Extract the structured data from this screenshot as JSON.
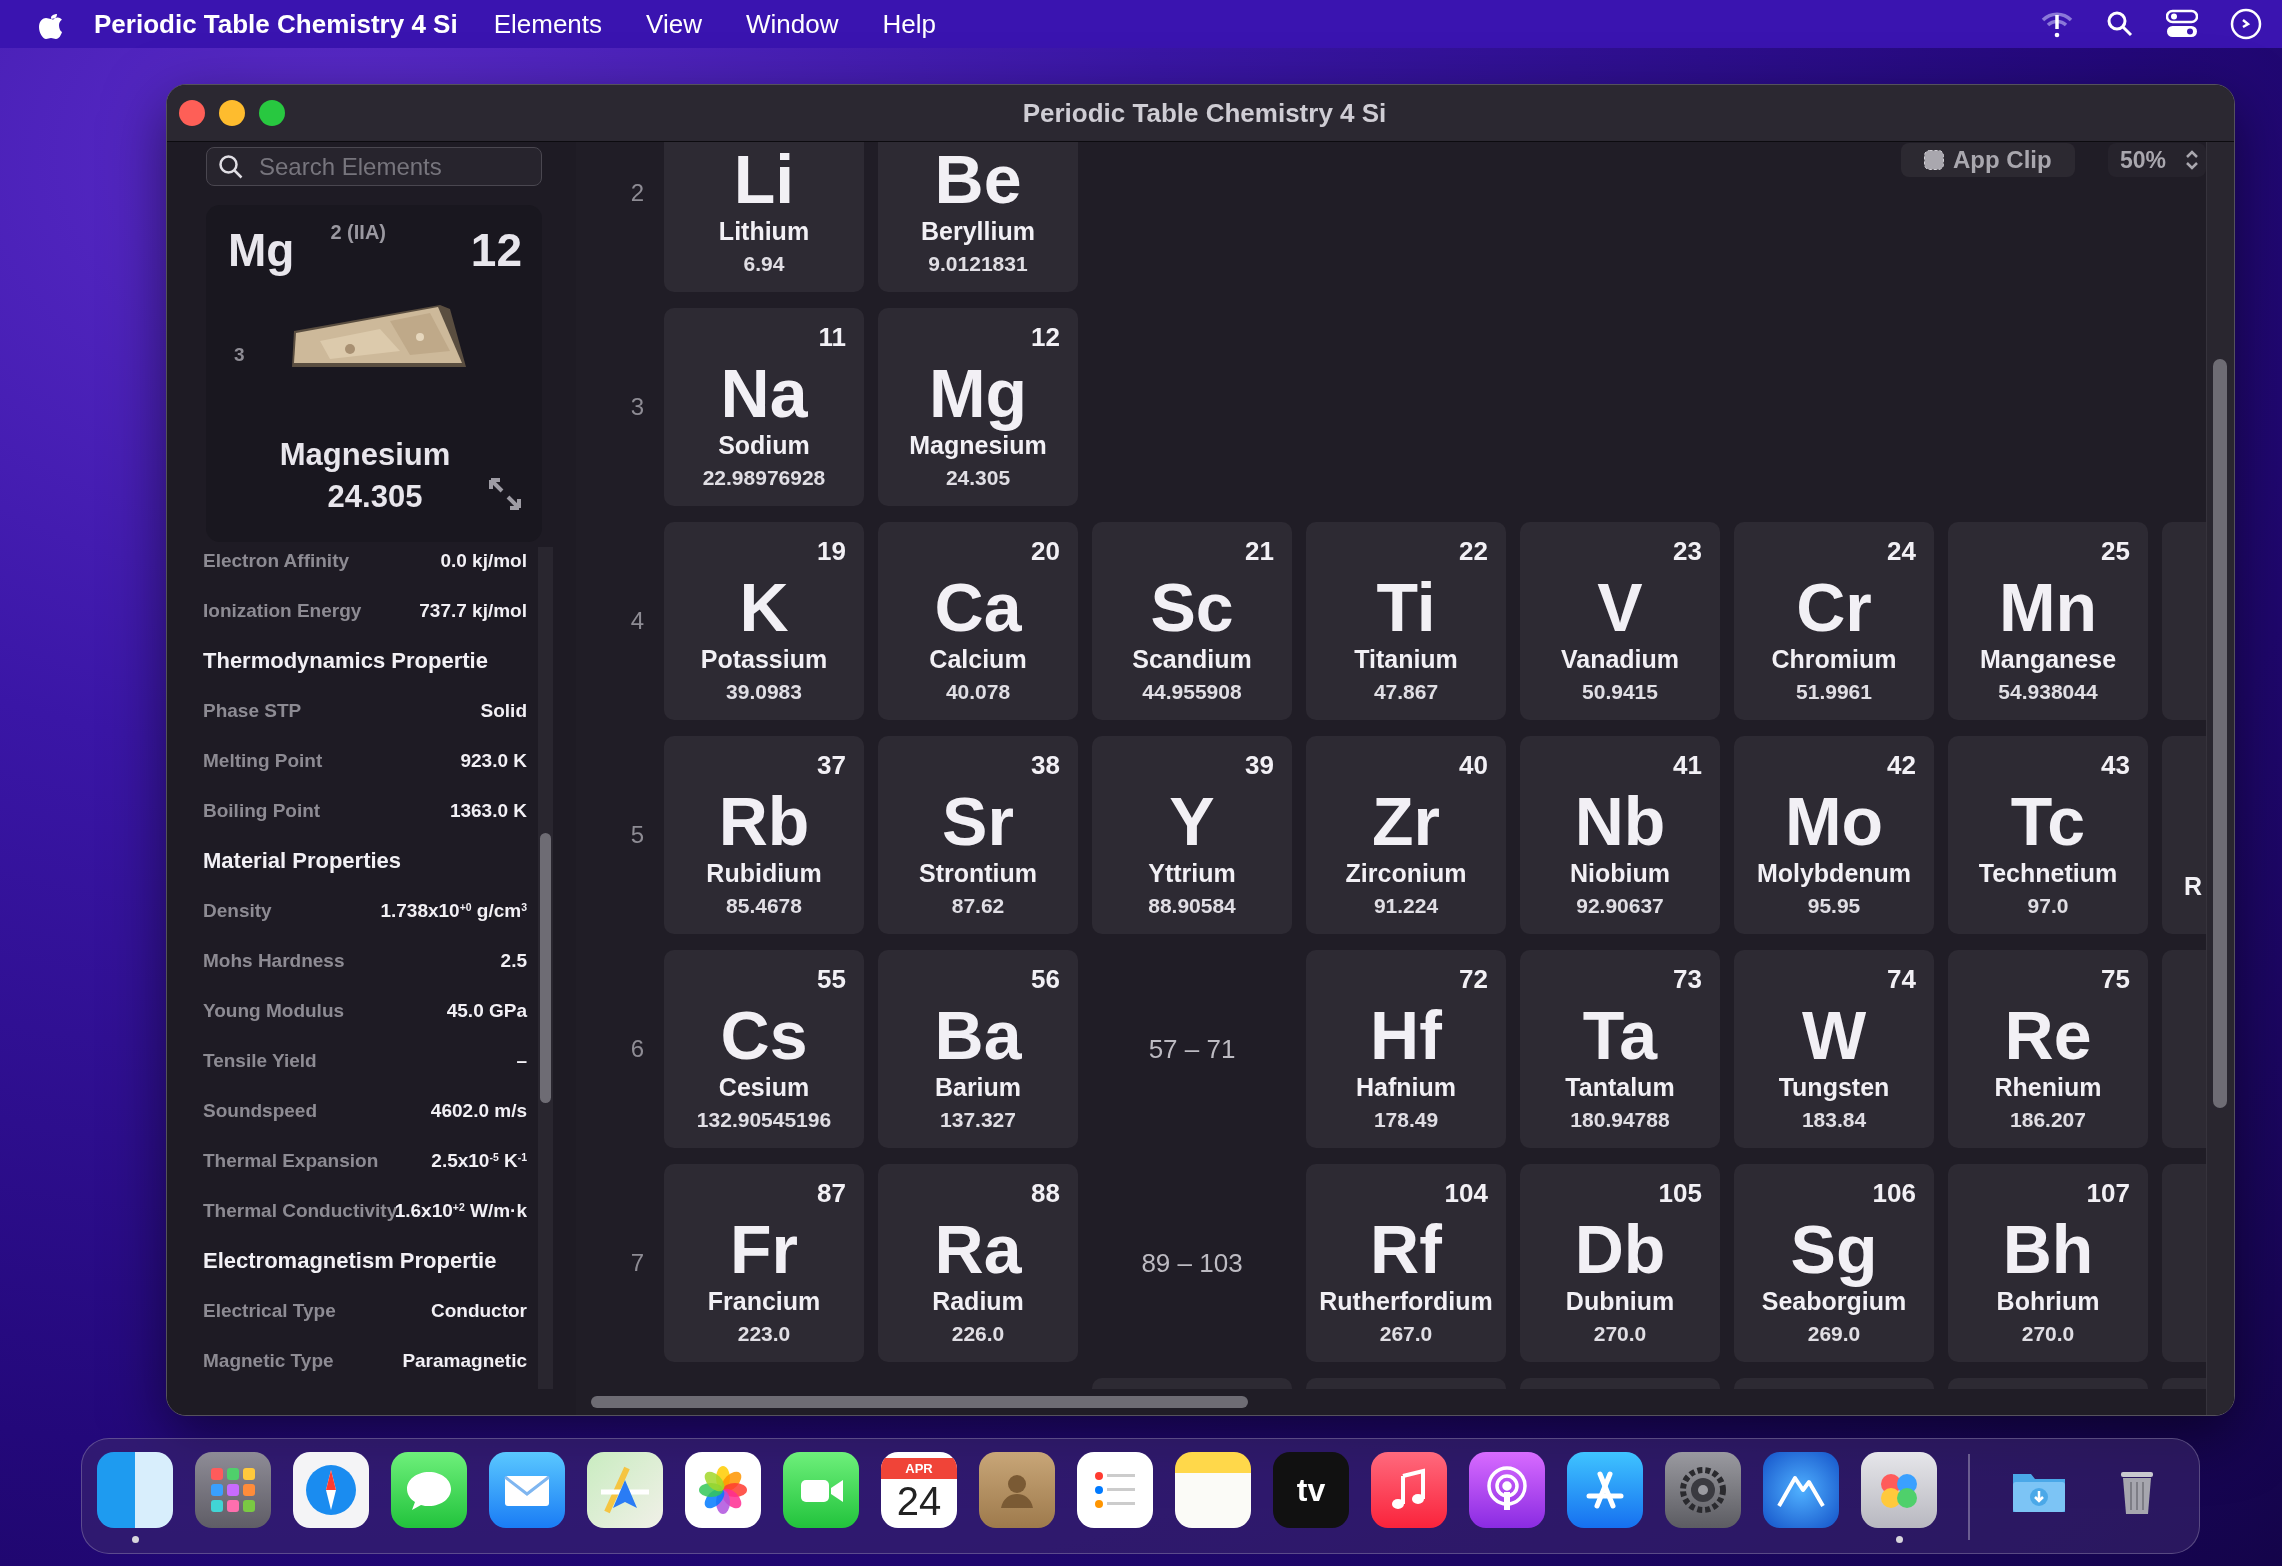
{
  "menu_bar": {
    "app_name": "Periodic Table Chemistry 4 Si",
    "items": [
      "Elements",
      "View",
      "Window",
      "Help"
    ]
  },
  "window": {
    "title": "Periodic Table Chemistry 4 Si"
  },
  "sidebar": {
    "search": {
      "placeholder": "Search Elements"
    },
    "detail": {
      "symbol": "Mg",
      "group": "2 (IIA)",
      "number": "12",
      "period": "3",
      "name": "Magnesium",
      "weight": "24.305"
    },
    "properties": [
      {
        "kind": "property",
        "label": "Electron Affinity",
        "value": "0.0 kj/mol"
      },
      {
        "kind": "property",
        "label": "Ionization Energy",
        "value": "737.7 kj/mol"
      },
      {
        "kind": "heading",
        "label": "Thermodynamics Propertie"
      },
      {
        "kind": "property",
        "label": "Phase STP",
        "value": "Solid"
      },
      {
        "kind": "property",
        "label": "Melting Point",
        "value": "923.0 K"
      },
      {
        "kind": "property",
        "label": "Boiling Point",
        "value": "1363.0 K"
      },
      {
        "kind": "heading",
        "label": "Material Properties"
      },
      {
        "kind": "property",
        "label": "Density",
        "value": "1.738x10$^{+0}$ g/cm$^{3}$"
      },
      {
        "kind": "property",
        "label": "Mohs Hardness",
        "value": "2.5"
      },
      {
        "kind": "property",
        "label": "Young Modulus",
        "value": "45.0 GPa"
      },
      {
        "kind": "property",
        "label": "Tensile Yield",
        "value": "–"
      },
      {
        "kind": "property",
        "label": "Soundspeed",
        "value": "4602.0 m/s"
      },
      {
        "kind": "property",
        "label": "Thermal Expansion",
        "value": "2.5x10$^{-5}$ K$^{-1}$"
      },
      {
        "kind": "property",
        "label": "Thermal Conductivity",
        "value": "1.6x10$^{+2}$ W/m·k"
      },
      {
        "kind": "heading",
        "label": "Electromagnetism Propertie"
      },
      {
        "kind": "property",
        "label": "Electrical Type",
        "value": "Conductor"
      },
      {
        "kind": "property",
        "label": "Magnetic Type",
        "value": "Paramagnetic"
      }
    ]
  },
  "toolbar": {
    "app_clip": "App Clip",
    "zoom": "50%"
  },
  "table": {
    "rows": [
      {
        "period": "2",
        "cells": [
          {
            "kind": "element",
            "symbol": "Li",
            "name": "Lithium",
            "weight": "6.94"
          },
          {
            "kind": "element",
            "symbol": "Be",
            "name": "Beryllium",
            "weight": "9.0121831"
          }
        ]
      },
      {
        "period": "3",
        "cells": [
          {
            "kind": "element",
            "number": "11",
            "symbol": "Na",
            "name": "Sodium",
            "weight": "22.98976928"
          },
          {
            "kind": "element",
            "number": "12",
            "symbol": "Mg",
            "name": "Magnesium",
            "weight": "24.305"
          }
        ]
      },
      {
        "period": "4",
        "cells": [
          {
            "kind": "element",
            "number": "19",
            "symbol": "K",
            "name": "Potassium",
            "weight": "39.0983"
          },
          {
            "kind": "element",
            "number": "20",
            "symbol": "Ca",
            "name": "Calcium",
            "weight": "40.078"
          },
          {
            "kind": "element",
            "number": "21",
            "symbol": "Sc",
            "name": "Scandium",
            "weight": "44.955908"
          },
          {
            "kind": "element",
            "number": "22",
            "symbol": "Ti",
            "name": "Titanium",
            "weight": "47.867"
          },
          {
            "kind": "element",
            "number": "23",
            "symbol": "V",
            "name": "Vanadium",
            "weight": "50.9415"
          },
          {
            "kind": "element",
            "number": "24",
            "symbol": "Cr",
            "name": "Chromium",
            "weight": "51.9961"
          },
          {
            "kind": "element",
            "number": "25",
            "symbol": "Mn",
            "name": "Manganese",
            "weight": "54.938044"
          },
          {
            "kind": "blank"
          }
        ]
      },
      {
        "period": "5",
        "cells": [
          {
            "kind": "element",
            "number": "37",
            "symbol": "Rb",
            "name": "Rubidium",
            "weight": "85.4678"
          },
          {
            "kind": "element",
            "number": "38",
            "symbol": "Sr",
            "name": "Strontium",
            "weight": "87.62"
          },
          {
            "kind": "element",
            "number": "39",
            "symbol": "Y",
            "name": "Yttrium",
            "weight": "88.90584"
          },
          {
            "kind": "element",
            "number": "40",
            "symbol": "Zr",
            "name": "Zirconium",
            "weight": "91.224"
          },
          {
            "kind": "element",
            "number": "41",
            "symbol": "Nb",
            "name": "Niobium",
            "weight": "92.90637"
          },
          {
            "kind": "element",
            "number": "42",
            "symbol": "Mo",
            "name": "Molybdenum",
            "weight": "95.95"
          },
          {
            "kind": "element",
            "number": "43",
            "symbol": "Tc",
            "name": "Technetium",
            "weight": "97.0"
          },
          {
            "kind": "edge",
            "name": "R"
          }
        ]
      },
      {
        "period": "6",
        "cells": [
          {
            "kind": "element",
            "number": "55",
            "symbol": "Cs",
            "name": "Cesium",
            "weight": "132.90545196"
          },
          {
            "kind": "element",
            "number": "56",
            "symbol": "Ba",
            "name": "Barium",
            "weight": "137.327"
          },
          {
            "kind": "range",
            "text": "57 – 71"
          },
          {
            "kind": "element",
            "number": "72",
            "symbol": "Hf",
            "name": "Hafnium",
            "weight": "178.49"
          },
          {
            "kind": "element",
            "number": "73",
            "symbol": "Ta",
            "name": "Tantalum",
            "weight": "180.94788"
          },
          {
            "kind": "element",
            "number": "74",
            "symbol": "W",
            "name": "Tungsten",
            "weight": "183.84"
          },
          {
            "kind": "element",
            "number": "75",
            "symbol": "Re",
            "name": "Rhenium",
            "weight": "186.207"
          },
          {
            "kind": "blank"
          }
        ]
      },
      {
        "period": "7",
        "cells": [
          {
            "kind": "element",
            "number": "87",
            "symbol": "Fr",
            "name": "Francium",
            "weight": "223.0"
          },
          {
            "kind": "element",
            "number": "88",
            "symbol": "Ra",
            "name": "Radium",
            "weight": "226.0"
          },
          {
            "kind": "range",
            "text": "89 – 103"
          },
          {
            "kind": "element",
            "number": "104",
            "symbol": "Rf",
            "name": "Rutherfordium",
            "weight": "267.0"
          },
          {
            "kind": "element",
            "number": "105",
            "symbol": "Db",
            "name": "Dubnium",
            "weight": "270.0"
          },
          {
            "kind": "element",
            "number": "106",
            "symbol": "Sg",
            "name": "Seaborgium",
            "weight": "269.0"
          },
          {
            "kind": "element",
            "number": "107",
            "symbol": "Bh",
            "name": "Bohrium",
            "weight": "270.0"
          },
          {
            "kind": "blank"
          }
        ]
      },
      {
        "cells": [
          {
            "kind": "gap"
          },
          {
            "kind": "gap"
          },
          {
            "kind": "blank"
          },
          {
            "kind": "blank"
          },
          {
            "kind": "blank"
          },
          {
            "kind": "blank"
          },
          {
            "kind": "blank"
          },
          {
            "kind": "blank"
          }
        ]
      }
    ]
  },
  "dock": {
    "items": [
      {
        "kind": "finder",
        "running": true
      },
      {
        "kind": "launchpad",
        "running": false
      },
      {
        "kind": "safari",
        "running": false
      },
      {
        "kind": "messages",
        "running": false
      },
      {
        "kind": "mail",
        "running": false
      },
      {
        "kind": "maps",
        "running": false
      },
      {
        "kind": "photos",
        "running": false
      },
      {
        "kind": "facetime",
        "running": false
      },
      {
        "kind": "calendar",
        "month": "APR",
        "day": "24",
        "running": false
      },
      {
        "kind": "contacts",
        "running": false
      },
      {
        "kind": "reminders",
        "running": false
      },
      {
        "kind": "notes",
        "running": false
      },
      {
        "kind": "tv",
        "label": "tv",
        "running": false
      },
      {
        "kind": "music",
        "running": false
      },
      {
        "kind": "podcasts",
        "running": false
      },
      {
        "kind": "appstore",
        "running": false
      },
      {
        "kind": "settings",
        "running": false
      },
      {
        "kind": "mountain",
        "running": false
      },
      {
        "kind": "periodic",
        "running": true
      },
      {
        "kind": "separator"
      },
      {
        "kind": "downloads",
        "running": false
      },
      {
        "kind": "trash",
        "running": false
      }
    ]
  }
}
